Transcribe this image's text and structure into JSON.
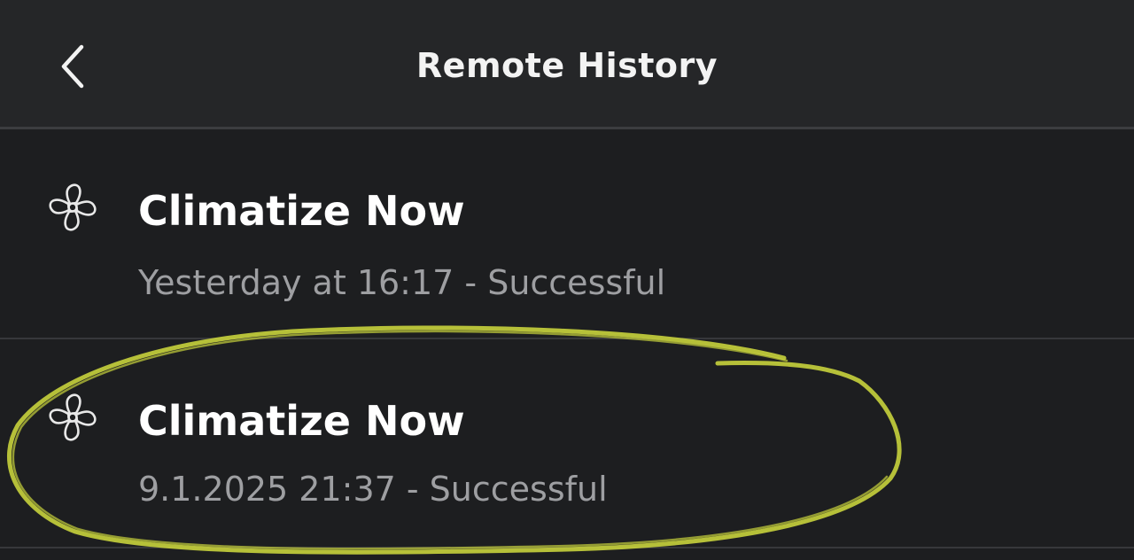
{
  "header": {
    "title": "Remote History",
    "back_icon": "chevron-left-icon"
  },
  "history": [
    {
      "title": "Climatize Now",
      "subtitle": "Yesterday at 16:17 - Successful",
      "icon": "fan-icon"
    },
    {
      "title": "Climatize Now",
      "subtitle": "9.1.2025 21:37 - Successful",
      "icon": "fan-icon"
    }
  ],
  "colors": {
    "background": "#1d1e20",
    "header_background": "#252628",
    "title_text": "#ffffff",
    "subtitle_text": "#9e9fa2",
    "annotation_marker": "#c8d23c"
  }
}
